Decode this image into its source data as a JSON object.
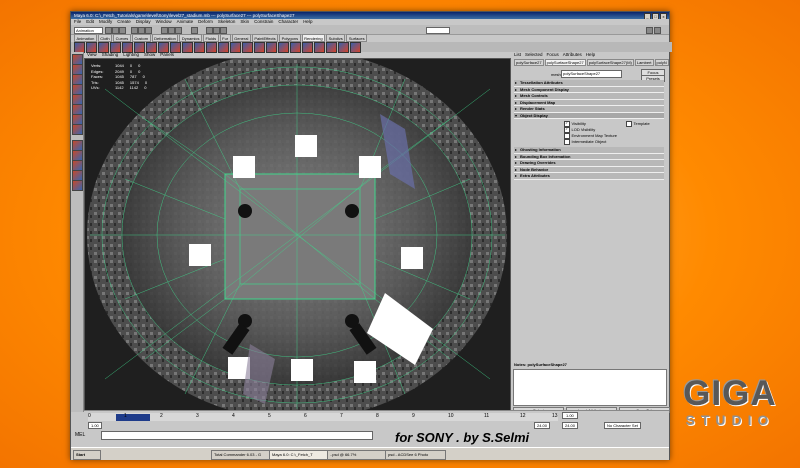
{
  "window": {
    "title": "Maya 6.0: C:\\_Fetch_Tutorials\\game\\level\\Sony\\level27_stadium.mb --- polySurface27 --- polySurfaceShape27",
    "buttons": [
      "_",
      "□",
      "x"
    ]
  },
  "menus": [
    "File",
    "Edit",
    "Modify",
    "Create",
    "Display",
    "Window",
    "Animate",
    "Deform",
    "Skeleton",
    "Skin",
    "Constrain",
    "Character",
    "Help"
  ],
  "status_line": {
    "mode": "Animation"
  },
  "shelf_tabs": [
    {
      "label": "Animation",
      "active": false
    },
    {
      "label": "Cloth",
      "active": false
    },
    {
      "label": "Curves",
      "active": false
    },
    {
      "label": "Custom",
      "active": false
    },
    {
      "label": "Deformation",
      "active": false
    },
    {
      "label": "Dynamics",
      "active": false
    },
    {
      "label": "Fluids",
      "active": false
    },
    {
      "label": "Fur",
      "active": false
    },
    {
      "label": "General",
      "active": false
    },
    {
      "label": "PaintEffects",
      "active": false
    },
    {
      "label": "Polygons",
      "active": false
    },
    {
      "label": "Rendering",
      "active": true
    },
    {
      "label": "Subdivs",
      "active": false
    },
    {
      "label": "Surfaces",
      "active": false
    }
  ],
  "panel_menu": [
    "View",
    "Shading",
    "Lighting",
    "Show",
    "Panels"
  ],
  "hud": [
    {
      "label": "Verts:",
      "v1": "1044",
      "v2": "0",
      "v3": "0"
    },
    {
      "label": "Edges:",
      "v1": "2049",
      "v2": "0",
      "v3": "0"
    },
    {
      "label": "Faces:",
      "v1": "1045",
      "v2": "787",
      "v3": "0"
    },
    {
      "label": "Tris:",
      "v1": "1045",
      "v2": "1574",
      "v3": "0"
    },
    {
      "label": "UVs:",
      "v1": "1142",
      "v2": "1142",
      "v3": "0"
    }
  ],
  "attribute_editor": {
    "menu": [
      "List",
      "Selected",
      "Focus",
      "Attributes",
      "Help"
    ],
    "tabs": [
      {
        "label": "polySurface27",
        "active": false
      },
      {
        "label": "polySurfaceShape27",
        "active": true
      },
      {
        "label": "polySurfaceShape27(M)",
        "active": false
      },
      {
        "label": "Lambert",
        "active": false
      },
      {
        "label": "polyN",
        "active": false
      }
    ],
    "node_label": "mesh:",
    "node_name": "polySurfaceShape27",
    "focus_button": "Focus",
    "presets_button": "Presets",
    "sections_top": [
      "Tessellation Attributes",
      "Mesh Component Display",
      "Mesh Controls",
      "Displacement Map",
      "Render Stats"
    ],
    "object_display_label": "Object Display",
    "object_display": {
      "visibility": "Visibility",
      "template": "Template",
      "lod_visibility": "LOD Visibility",
      "env_map": "Environment Map Texture",
      "intermediate": "Intermediate Object"
    },
    "sections_bottom": [
      "Ghosting Information",
      "Bounding Box Information",
      "Drawing Overrides",
      "Node Behavior",
      "Extra Attributes"
    ],
    "notes_label": "Notes: polySurfaceShape27",
    "bottom_buttons": [
      "Select",
      "Load Attributes",
      "Copy Tab"
    ]
  },
  "time_slider": {
    "ticks": [
      "0",
      "1",
      "2",
      "3",
      "4",
      "5",
      "6",
      "7",
      "8",
      "9",
      "10",
      "11",
      "12",
      "13"
    ],
    "current": "1.00",
    "end": "24.00",
    "range_start": "1.00",
    "range_end": "24.00",
    "character_set": "No Character Set"
  },
  "command_line": {
    "label": "MEL"
  },
  "taskbar": [
    {
      "label": "Start",
      "active": false
    },
    {
      "label": "Total Commander 6.03 - G",
      "active": false
    },
    {
      "label": "Maya 6.0: C:\\_Fetch_T",
      "active": true
    },
    {
      "label": "..psd @ 66.7%",
      "active": false
    },
    {
      "label": "psd - ACDSee 6 Photo",
      "active": false
    }
  ],
  "credit": "for SONY . by S.Selmi",
  "logo": {
    "line1": "GIGA",
    "line2": "STUDIO"
  }
}
